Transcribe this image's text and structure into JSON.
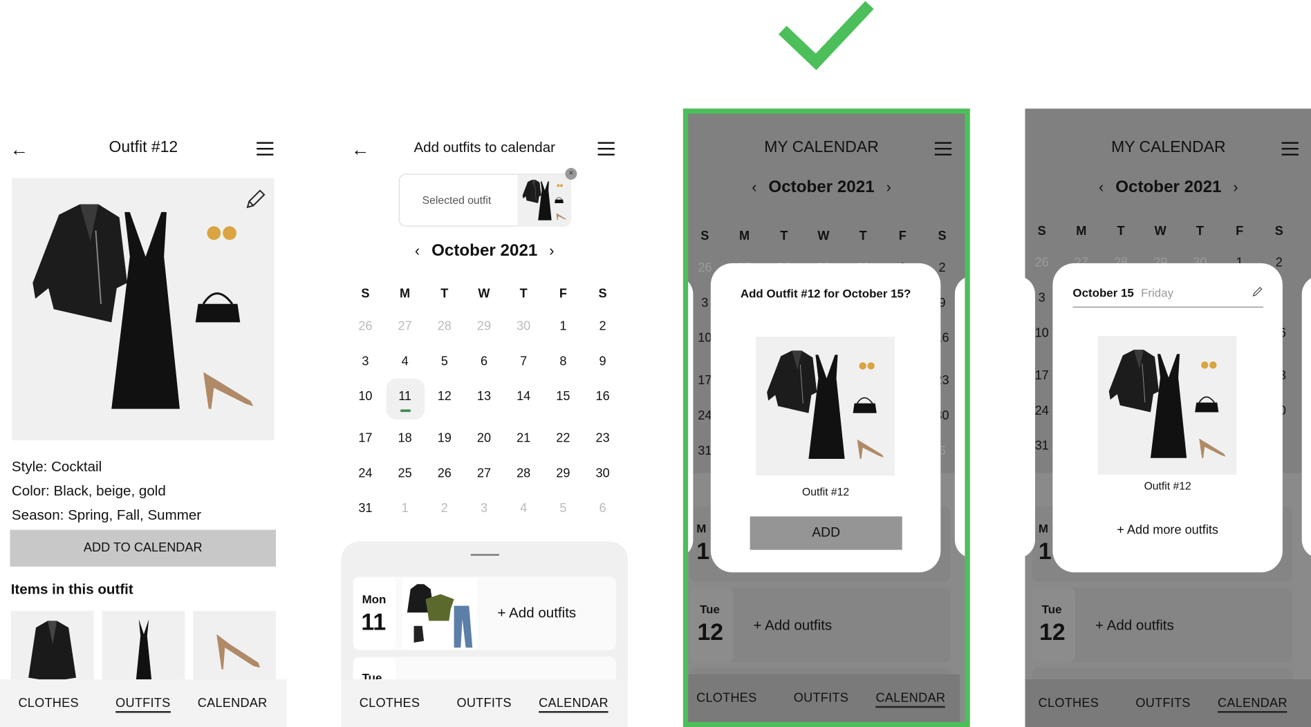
{
  "checkmark": {
    "icon": "checkmark-icon",
    "color": "#4cbf5a"
  },
  "highlight_color": "#4cbf5a",
  "nav": {
    "items": [
      "CLOTHES",
      "OUTFITS",
      "CALENDAR"
    ]
  },
  "outfit_detail": {
    "title": "Outfit #12",
    "style_label": "Style:",
    "style": " Cocktail",
    "color_label": "Color:",
    "color": " Black, beige, gold",
    "season_label": "Season:",
    "season": " Spring, Fall, Summer",
    "add_button": "ADD TO CALENDAR",
    "items_heading": "Items in this outfit",
    "items": [
      "leather-jacket",
      "black-slip-dress",
      "beige-heels"
    ],
    "active_nav": "OUTFITS"
  },
  "calendar_picker": {
    "title": "Add outfits to calendar",
    "selected_label": "Selected outfit",
    "month": "October 2021",
    "selected_day": "11",
    "day_card": {
      "dow": "Mon",
      "day": "11",
      "action": "+ Add outfits"
    },
    "next_card_dow": "Tue",
    "active_nav": "CALENDAR"
  },
  "calendar": {
    "weekdays": [
      "S",
      "M",
      "T",
      "W",
      "T",
      "F",
      "S"
    ],
    "weeks": [
      [
        "26",
        "27",
        "28",
        "29",
        "30",
        "1",
        "2"
      ],
      [
        "3",
        "4",
        "5",
        "6",
        "7",
        "8",
        "9"
      ],
      [
        "10",
        "11",
        "12",
        "13",
        "14",
        "15",
        "16"
      ],
      [
        "17",
        "18",
        "19",
        "20",
        "21",
        "22",
        "23"
      ],
      [
        "24",
        "25",
        "26",
        "27",
        "28",
        "29",
        "30"
      ],
      [
        "31",
        "1",
        "2",
        "3",
        "4",
        "5",
        "6"
      ]
    ]
  },
  "my_calendar": {
    "title": "MY CALENDAR",
    "month": "October 2021",
    "confirm_modal": {
      "question": "Add Outfit #12 for October 15?",
      "outfit_name": "Outfit #12",
      "add_button": "ADD"
    },
    "day_modal": {
      "date": "October 15",
      "weekday": "Friday",
      "outfit_name": "Outfit #12",
      "add_more": "+ Add more outfits"
    },
    "mon_card": {
      "dow": "M",
      "day": "1"
    },
    "tue_card": {
      "dow": "Tue",
      "day": "12",
      "action": "+ Add outfits"
    },
    "active_nav": "CALENDAR"
  }
}
